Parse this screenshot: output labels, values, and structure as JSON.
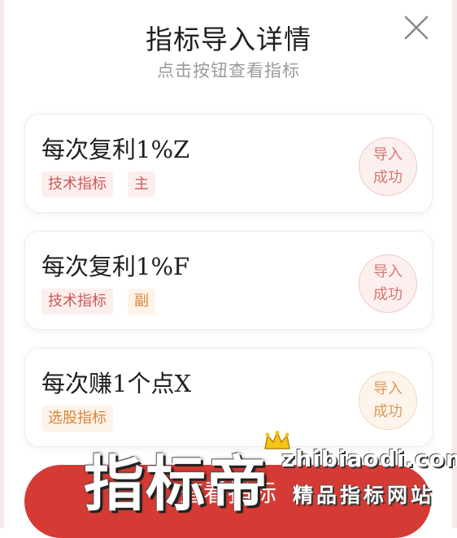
{
  "dialog": {
    "title": "指标导入详情",
    "subtitle": "点击按钮查看指标"
  },
  "items": [
    {
      "name": "每次复利1%Z",
      "tags": [
        "技术指标",
        "主"
      ],
      "status_line1": "导入",
      "status_line2": "成功"
    },
    {
      "name": "每次复利1%F",
      "tags": [
        "技术指标",
        "副"
      ],
      "status_line1": "导入",
      "status_line2": "成功"
    },
    {
      "name": "每次赚1个点X",
      "tags": [
        "选股指标"
      ],
      "status_line1": "导入",
      "status_line2": "成功"
    }
  ],
  "bottom_button": {
    "label": "查看指标"
  },
  "watermark": {
    "brand": "指标帝",
    "url": "zhibiaodi.com",
    "slogan": "精品指标网站"
  },
  "colors": {
    "accent": "#d53b34",
    "tag_red_text": "#c95b57",
    "tag_orange_text": "#d5863c"
  }
}
